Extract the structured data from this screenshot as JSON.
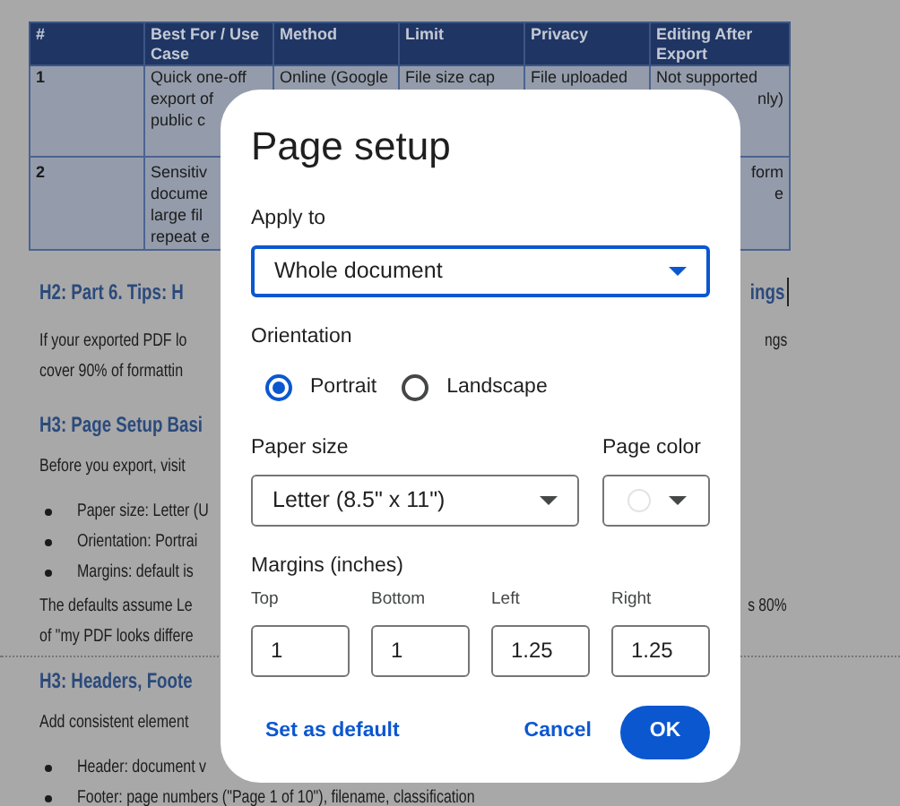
{
  "document": {
    "table": {
      "columns": [
        "#",
        "Best For / Use Case",
        "Method",
        "Limit",
        "Privacy",
        "Editing After Export"
      ],
      "rows": [
        {
          "cells": [
            {
              "lines": [
                "1"
              ]
            },
            {
              "lines": [
                "Quick one-off",
                "export of",
                "public c"
              ]
            },
            {
              "lines": [
                "Online (Google"
              ]
            },
            {
              "lines": [
                "File size cap"
              ]
            },
            {
              "lines": [
                "File uploaded"
              ]
            },
            {
              "lines": [
                "Not supported"
              ],
              "cut_lines": [
                "nly)"
              ]
            }
          ]
        },
        {
          "cells": [
            {
              "lines": [
                "2"
              ]
            },
            {
              "lines": [
                "Sensitiv",
                "docume",
                "large fil",
                "repeat e"
              ]
            },
            {},
            {},
            {},
            {
              "cut_lines": [
                "form",
                "e"
              ]
            }
          ]
        }
      ]
    },
    "blocks": [
      {
        "kind": "h2",
        "left": "H2: Part 6. Tips: H",
        "right": "ings",
        "cursor": true
      },
      {
        "kind": "line",
        "left": "If your exported PDF lo",
        "right": "ngs"
      },
      {
        "kind": "line",
        "left": "cover 90% of formattin"
      },
      {
        "kind": "h3",
        "left": "H3: Page Setup Basi"
      },
      {
        "kind": "line",
        "left": "Before you export, visit"
      },
      {
        "kind": "bullet",
        "left": "Paper size: Letter (U"
      },
      {
        "kind": "bullet",
        "left": "Orientation: Portrai"
      },
      {
        "kind": "bullet",
        "left": "Margins: default is"
      },
      {
        "kind": "line",
        "left": "The defaults assume Le",
        "right": "s 80%"
      },
      {
        "kind": "line",
        "left": "of \"my PDF looks differe"
      },
      {
        "kind": "break"
      },
      {
        "kind": "h3",
        "left": "H3: Headers, Foote"
      },
      {
        "kind": "line",
        "left": "Add consistent element"
      },
      {
        "kind": "bullet",
        "left": "Header: document v"
      },
      {
        "kind": "bullet",
        "left": "Footer: page numbers (\"Page 1 of 10\"), filename, classification"
      }
    ]
  },
  "dialog": {
    "title": "Page setup",
    "apply_to": {
      "label": "Apply to",
      "value": "Whole document",
      "focused": true
    },
    "orientation": {
      "label": "Orientation",
      "options": [
        {
          "label": "Portrait",
          "selected": true
        },
        {
          "label": "Landscape",
          "selected": false
        }
      ]
    },
    "paper_size": {
      "label": "Paper size",
      "value": "Letter (8.5\" x 11\")"
    },
    "page_color": {
      "label": "Page color",
      "color": "#ffffff"
    },
    "margins": {
      "label": "Margins (inches)",
      "fields": [
        {
          "label": "Top",
          "value": "1"
        },
        {
          "label": "Bottom",
          "value": "1"
        },
        {
          "label": "Left",
          "value": "1.25"
        },
        {
          "label": "Right",
          "value": "1.25"
        }
      ]
    },
    "buttons": {
      "set_default": "Set as default",
      "cancel": "Cancel",
      "ok": "OK"
    }
  }
}
